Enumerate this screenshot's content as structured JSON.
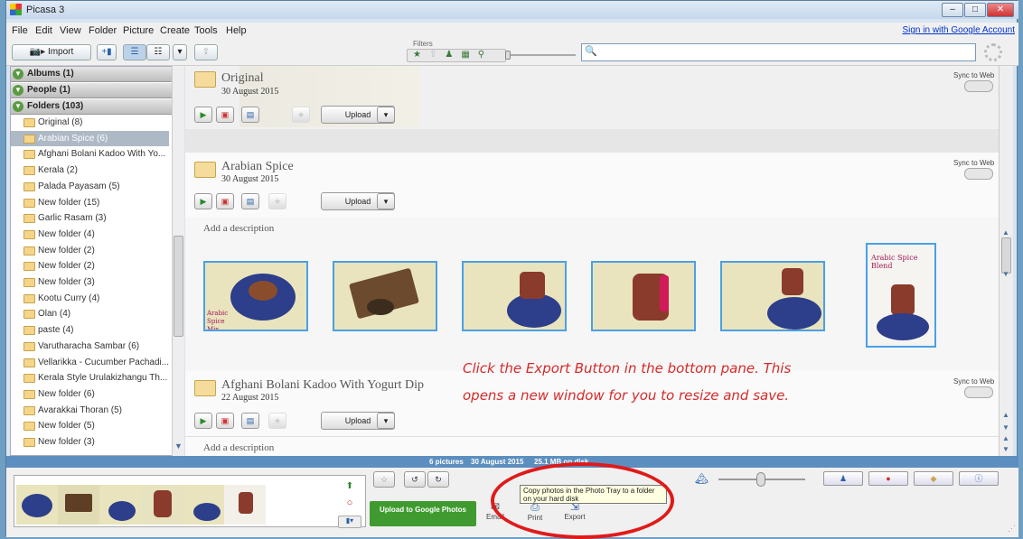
{
  "window": {
    "title": "Picasa 3",
    "minimize": "–",
    "maximize": "□",
    "close": "✕"
  },
  "menu": [
    "File",
    "Edit",
    "View",
    "Folder",
    "Picture",
    "Create",
    "Tools",
    "Help"
  ],
  "signin": "Sign in with Google Account",
  "toolbar": {
    "import": "Import",
    "filters_label": "Filters"
  },
  "sidebar": {
    "groups": [
      {
        "label": "Albums (1)"
      },
      {
        "label": "People (1)"
      },
      {
        "label": "Folders (103)"
      }
    ],
    "folders": [
      "Original (8)",
      "Arabian Spice (6)",
      "Afghani Bolani Kadoo With Yo...",
      "Kerala (2)",
      "Palada Payasam (5)",
      "New folder (15)",
      "Garlic Rasam (3)",
      "New folder (4)",
      "New folder (2)",
      "New folder (2)",
      "New folder (3)",
      "Kootu Curry (4)",
      "Olan (4)",
      "paste (4)",
      "Varutharacha Sambar (6)",
      "Vellarikka - Cucumber Pachadi...",
      "Kerala Style Urulakizhangu Th...",
      "New folder (6)",
      "Avarakkai Thoran (5)",
      "New folder (5)",
      "New folder (3)"
    ],
    "selected_index": 1
  },
  "sections": [
    {
      "title": "Original",
      "date": "30 August 2015",
      "sync": "Sync to Web",
      "upload": "Upload"
    },
    {
      "title": "Arabian Spice",
      "date": "30 August 2015",
      "sync": "Sync to Web",
      "upload": "Upload",
      "desc": "Add a description"
    },
    {
      "title": "Afghani Bolani Kadoo With Yogurt Dip",
      "date": "22 August 2015",
      "sync": "Sync to Web",
      "upload": "Upload",
      "desc": "Add a description"
    }
  ],
  "thumbs": {
    "first_caption": "Arabic Spice Mix",
    "last_caption": "Arabic Spice Blend"
  },
  "annotation": "Click the Export Button in the bottom pane. This opens a new window for you to resize and save.",
  "status": {
    "count": "6 pictures",
    "date": "30 August 2015",
    "size": "25.1 MB on disk"
  },
  "bottom": {
    "upload_google": "Upload to Google Photos",
    "email": "Email",
    "print": "Print",
    "export": "Export",
    "tooltip": "Copy photos in the Photo Tray to a folder on your hard disk"
  },
  "colors": {
    "accent": "#5c8fbf",
    "upload_green": "#3f9b2f",
    "annotation": "#d52b2b"
  }
}
